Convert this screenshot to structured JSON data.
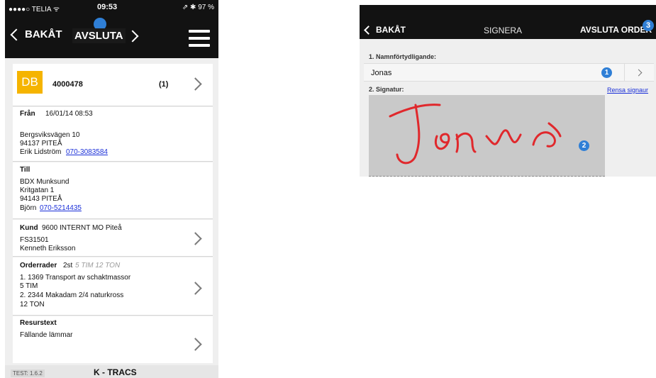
{
  "left_phone": {
    "status_bar": {
      "carrier": "●●●●○ TELIA ᯤ",
      "time": "09:53",
      "battery": "⇗ ✱ 97 %"
    },
    "nav": {
      "back_label": "BAKÅT",
      "finish_label": "AVSLUTA"
    },
    "order": {
      "badge": "DB",
      "number": "4000478",
      "count": "(1)"
    },
    "from": {
      "label": "Från",
      "datetime": "16/01/14 08:53",
      "street": "Bergsviksvägen 10",
      "postal": "94137 PITEÅ",
      "contact_name": "Erik Lidström",
      "contact_phone": "070-3083584"
    },
    "to": {
      "label": "Till",
      "company": "BDX Munksund",
      "street": "Kritgatan 1",
      "postal": "94143 PITEÅ",
      "contact_name": "Björn",
      "contact_phone": "070-5214435"
    },
    "customer": {
      "label": "Kund",
      "value": "9600 INTERNT MO Piteå",
      "code": "FS31501",
      "person": "Kenneth Eriksson"
    },
    "order_rows": {
      "label": "Orderrader",
      "count": "2st",
      "summary": "5 TIM 12 TON",
      "line1": "1. 1369 Transport av schaktmassor",
      "line1_qty": "5 TIM",
      "line2": "2. 2344 Makadam 2/4 naturkross",
      "line2_qty": "12 TON"
    },
    "resource": {
      "label": "Resurstext",
      "value": "Fällande lämmar"
    },
    "footer": {
      "version": "TEST: 1.6.2",
      "brand": "K - TRACS"
    }
  },
  "right_phone": {
    "nav": {
      "back_label": "BAKÅT",
      "title": "SIGNERA",
      "finish_label": "AVSLUTA ORDER",
      "finish_marker": "3"
    },
    "name_section": {
      "label": "1. Namnförtydligande:",
      "value": "Jonas",
      "marker": "1"
    },
    "signature_section": {
      "label": "2. Signatur:",
      "clear_label": "Rensa signaur",
      "marker": "2"
    }
  },
  "colors": {
    "nav_bg": "#121212",
    "accent_badge": "#f5b400",
    "marker_blue": "#2f7fd6",
    "link": "#1a2fd8",
    "signature_ink": "#e0282c"
  }
}
